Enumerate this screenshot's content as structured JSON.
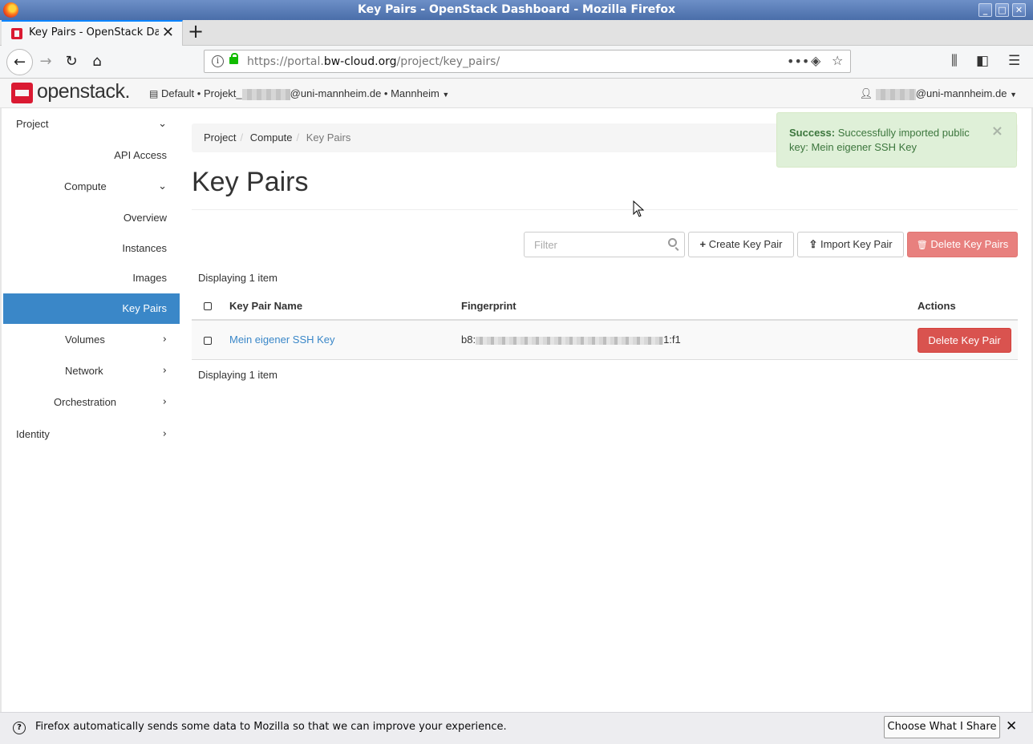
{
  "window": {
    "title": "Key Pairs - OpenStack Dashboard - Mozilla Firefox"
  },
  "tab": {
    "label": "Key Pairs - OpenStack Dashboard"
  },
  "url": {
    "prefix": "https://portal.",
    "domain": "bw-cloud.org",
    "path": "/project/key_pairs/"
  },
  "header": {
    "logo_text": "openstack.",
    "domain": "Default",
    "project_prefix": "Projekt_",
    "project_suffix": "@uni-mannheim.de",
    "region": "Mannheim",
    "user_suffix": "@uni-mannheim.de"
  },
  "sidebar": {
    "project": "Project",
    "api_access": "API Access",
    "compute": "Compute",
    "overview": "Overview",
    "instances": "Instances",
    "images": "Images",
    "key_pairs": "Key Pairs",
    "volumes": "Volumes",
    "network": "Network",
    "orchestration": "Orchestration",
    "identity": "Identity"
  },
  "breadcrumb": {
    "project": "Project",
    "compute": "Compute",
    "current": "Key Pairs"
  },
  "page": {
    "title": "Key Pairs"
  },
  "toolbar": {
    "filter_placeholder": "Filter",
    "create": "Create Key Pair",
    "import": "Import Key Pair",
    "delete": "Delete Key Pairs"
  },
  "table": {
    "count_text": "Displaying 1 item",
    "headers": {
      "name": "Key Pair Name",
      "fingerprint": "Fingerprint",
      "actions": "Actions"
    },
    "rows": [
      {
        "name": "Mein eigener SSH Key",
        "fp_start": "b8:",
        "fp_end": "1:f1",
        "action": "Delete Key Pair"
      }
    ]
  },
  "alert": {
    "strong": "Success:",
    "message": "Successfully imported public key: Mein eigener SSH Key"
  },
  "notification": {
    "text": "Firefox automatically sends some data to Mozilla so that we can improve your experience.",
    "button": "Choose What I Share"
  },
  "colors": {
    "primary": "#3a87c8",
    "danger": "#d9534f",
    "success_bg": "#dff0d8",
    "brand": "#da1a32"
  }
}
